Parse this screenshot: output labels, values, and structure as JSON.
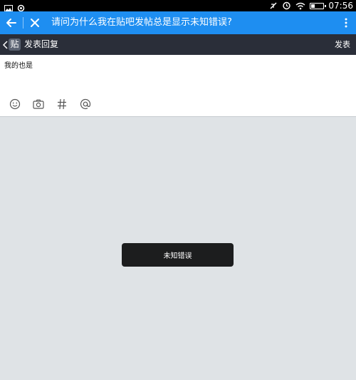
{
  "status_bar": {
    "time": "07:56",
    "battery_level": 0.35,
    "icons": [
      "gallery-icon",
      "settings-icon",
      "mute-icon",
      "alarm-icon",
      "wifi-icon",
      "battery-icon"
    ]
  },
  "app_bar": {
    "title": "请问为什么我在贴吧发帖总是显示未知错误?",
    "icons": [
      "back-arrow-icon",
      "close-icon",
      "more-vert-icon"
    ]
  },
  "sub_bar": {
    "logo": "贴",
    "title": "发表回复",
    "publish_label": "发表"
  },
  "compose": {
    "text": "我的也是",
    "tools": [
      "emoji-icon",
      "camera-icon",
      "hashtag-icon",
      "at-icon"
    ]
  },
  "toast": {
    "message": "未知错误"
  },
  "colors": {
    "accent": "#1e8ef1",
    "subbar": "#2a2e39",
    "background": "#dfe3e6",
    "toast": "#1c1d1e"
  }
}
